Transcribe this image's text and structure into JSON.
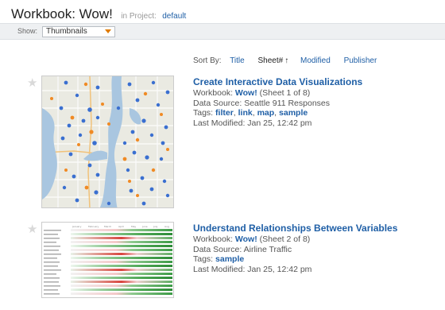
{
  "header": {
    "title": "Workbook: Wow!",
    "in_project": "in Project:",
    "project": "default"
  },
  "toolbar": {
    "show_label": "Show:",
    "show_value": "Thumbnails"
  },
  "sort": {
    "label": "Sort By:",
    "options": [
      "Title",
      "Sheet#",
      "Modified",
      "Publisher"
    ],
    "active_arrow": "↑"
  },
  "items": [
    {
      "title": "Create Interactive Data Visualizations",
      "workbook_prefix": "Workbook:",
      "workbook": "Wow!",
      "sheet": "(Sheet 1 of 8)",
      "datasource": "Data Source: Seattle 911 Responses",
      "tags_label": "Tags:",
      "tags": [
        "filter",
        "link",
        "map",
        "sample"
      ],
      "modified": "Last Modified: Jan 25, 12:42 pm"
    },
    {
      "title": "Understand Relationships Between Variables",
      "workbook_prefix": "Workbook:",
      "workbook": "Wow!",
      "sheet": "(Sheet 2 of 8)",
      "datasource": "Data Source: Airline Traffic",
      "tags_label": "Tags:",
      "tags": [
        "sample"
      ],
      "modified": "Last Modified: Jan 25, 12:42 pm"
    }
  ],
  "colors": {
    "link": "#1f5fa6",
    "toolbar_bg": "#eef0f2",
    "accent_orange": "#e07b00",
    "map_water": "#a9c6e0",
    "map_land": "#eaeae2",
    "dot_blue": "#3a6fd0",
    "dot_orange": "#f08a24"
  },
  "icons": {
    "favorite": "star-icon",
    "dropdown": "chevron-down-icon"
  }
}
